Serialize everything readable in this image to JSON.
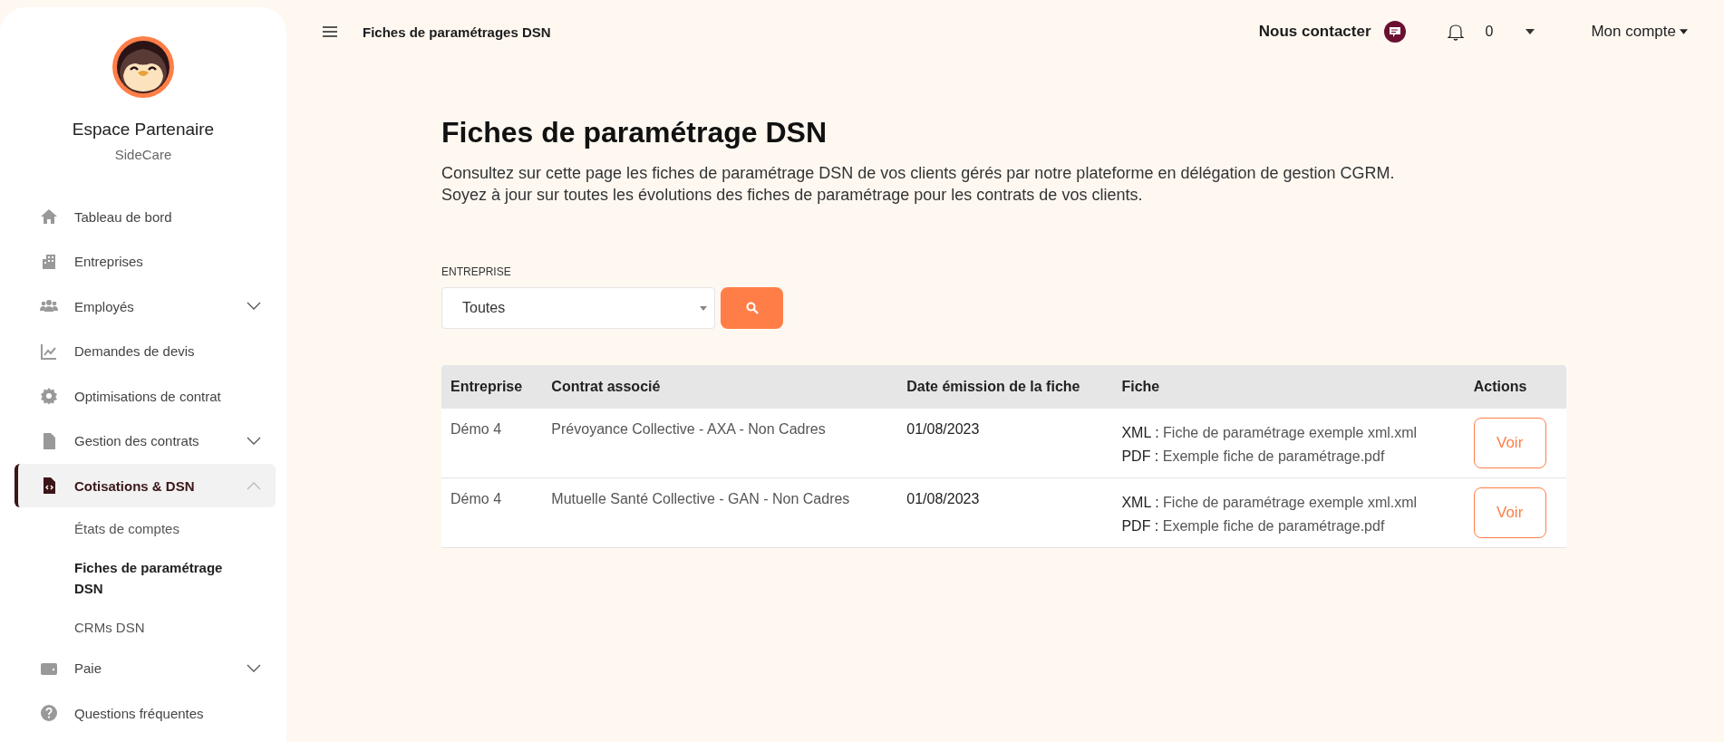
{
  "sidebar": {
    "title": "Espace Partenaire",
    "subtitle": "SideCare",
    "items": [
      {
        "label": "Tableau de bord",
        "selected": false
      },
      {
        "label": "Entreprises",
        "selected": false
      },
      {
        "label": "Employés",
        "selected": false,
        "expanded": false
      },
      {
        "label": "Demandes de devis",
        "selected": false
      },
      {
        "label": "Optimisations de contrat",
        "selected": false
      },
      {
        "label": "Gestion des contrats",
        "selected": false,
        "expanded": false
      },
      {
        "label": "Cotisations & DSN",
        "selected": true,
        "expanded": true,
        "children": [
          {
            "label": "États de comptes",
            "selected": false
          },
          {
            "label": "Fiches de paramétrage DSN",
            "selected": true
          },
          {
            "label": "CRMs DSN",
            "selected": false
          }
        ]
      },
      {
        "label": "Paie",
        "selected": false,
        "expanded": false
      },
      {
        "label": "Questions fréquentes",
        "selected": false
      }
    ]
  },
  "topbar": {
    "breadcrumb": "Fiches de paramétrages DSN",
    "contact": "Nous contacter",
    "notifications": "0",
    "account": "Mon compte"
  },
  "page": {
    "title": "Fiches de paramétrage DSN",
    "description": [
      "Consultez sur cette page les fiches de paramétrage DSN de vos clients gérés par notre plateforme en délégation de gestion CGRM.",
      "Soyez à jour sur toutes les évolutions des fiches de paramétrage pour les contrats de vos clients."
    ]
  },
  "filter": {
    "label": "ENTREPRISE",
    "value": "Toutes"
  },
  "table": {
    "columns": [
      "Entreprise",
      "Contrat associé",
      "Date émission de la fiche",
      "Fiche",
      "Actions"
    ],
    "rows": [
      {
        "entreprise": "Démo 4",
        "contrat": "Prévoyance Collective - AXA - Non Cadres",
        "date": "01/08/2023",
        "files": [
          {
            "label": "XML :",
            "name": "Fiche de paramétrage exemple xml.xml"
          },
          {
            "label": "PDF :",
            "name": "Exemple fiche de paramétrage.pdf"
          }
        ],
        "action": "Voir"
      },
      {
        "entreprise": "Démo 4",
        "contrat": "Mutuelle Santé Collective - GAN - Non Cadres",
        "date": "01/08/2023",
        "files": [
          {
            "label": "XML :",
            "name": "Fiche de paramétrage exemple xml.xml"
          },
          {
            "label": "PDF :",
            "name": "Exemple fiche de paramétrage.pdf"
          }
        ],
        "action": "Voir"
      }
    ]
  }
}
